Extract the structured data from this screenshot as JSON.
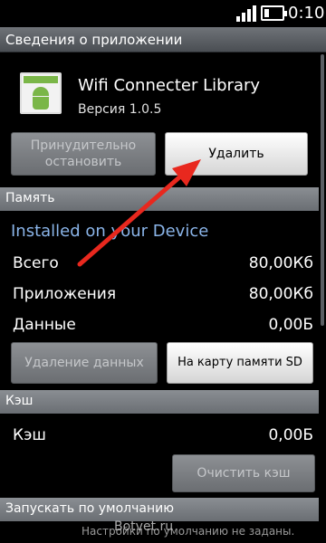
{
  "status_bar": {
    "time": "0:10",
    "signal_level": 4,
    "battery_level_percent": 30
  },
  "title_bar": {
    "title": "Сведения о приложении"
  },
  "app": {
    "name": "Wifi Connecter Library",
    "version": "Версия 1.0.5"
  },
  "actions": {
    "force_stop_label": "Принудительно\nостановить",
    "uninstall_label": "Удалить"
  },
  "memory": {
    "header": "Память",
    "installed_on": "Installed on your Device",
    "rows": [
      {
        "label": "Всего",
        "value": "80,00Кб"
      },
      {
        "label": "Приложения",
        "value": "80,00Кб"
      },
      {
        "label": "Данные",
        "value": "0,00Б"
      }
    ],
    "clear_data_label": "Удаление данных",
    "move_sd_label": "На карту памяти SD"
  },
  "cache": {
    "header": "Кэш",
    "label": "Кэш",
    "value": "0,00Б",
    "clear_cache_label": "Очистить кэш"
  },
  "launch": {
    "header": "Запускать по умолчанию",
    "subtitle": "Настройки по умолчанию не заданы."
  },
  "watermark": "Botvet.ru",
  "colors": {
    "section_header": "#7a7e83",
    "installed_text": "#8ab4e8",
    "arrow": "#e8281e"
  }
}
